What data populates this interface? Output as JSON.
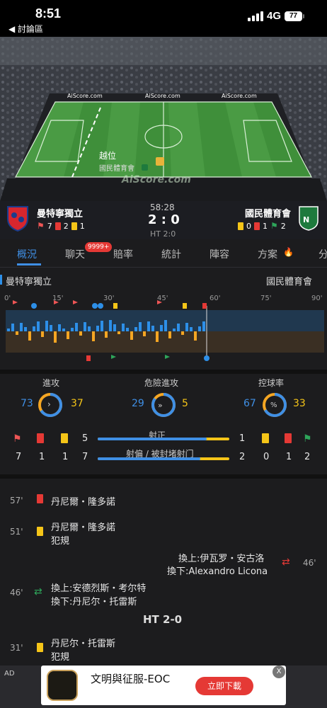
{
  "status": {
    "time": "8:51",
    "back": "◀ 討論區",
    "network": "4G",
    "battery": "77"
  },
  "pitch": {
    "brand": "AiScore.com",
    "watermark": "AiScore.com",
    "event": "越位",
    "event_team": "國民體育會"
  },
  "match": {
    "home": "曼特寧獨立",
    "away": "國民體育會",
    "clock": "58:28",
    "score": "2 : 0",
    "ht": "HT 2:0",
    "home_counts": {
      "corners": "7",
      "red": "2",
      "yellow": "1"
    },
    "away_counts": {
      "yellow": "0",
      "red": "1",
      "corners": "2"
    }
  },
  "tabs": [
    {
      "label": "概況"
    },
    {
      "label": "聊天",
      "badge": "9999+"
    },
    {
      "label": "賠率"
    },
    {
      "label": "統計"
    },
    {
      "label": "陣容"
    },
    {
      "label": "方案"
    },
    {
      "label": "分"
    }
  ],
  "teams_row": {
    "home": "曼特寧獨立",
    "away": "國民體育會"
  },
  "timeline": {
    "ticks": [
      "0'",
      "15'",
      "30'",
      "45'",
      "60'",
      "75'",
      "90'"
    ]
  },
  "stats": {
    "attack": {
      "label": "進攻",
      "home": "73",
      "away": "37",
      "home_share": 0.66
    },
    "danger": {
      "label": "危險進攻",
      "home": "29",
      "away": "5",
      "home_share": 0.85
    },
    "possession": {
      "label": "控球率",
      "home": "67",
      "away": "33",
      "home_share": 0.67
    },
    "on_target": {
      "label": "射正",
      "home": "5",
      "away": "1",
      "home_share": 0.83
    },
    "off_target": {
      "label": "射偏 / 被封堵射门",
      "home": "7",
      "away": "2",
      "home_share": 0.78
    },
    "home_icons": {
      "corners": "7",
      "red": "1",
      "yellow": "1"
    },
    "away_icons": {
      "yellow": "0",
      "red": "1",
      "corners": "2"
    }
  },
  "events": [
    {
      "minute": "57'",
      "side": "home",
      "type": "red",
      "text": "丹尼爾・隆多諾",
      "sub": ""
    },
    {
      "minute": "51'",
      "side": "home",
      "type": "yellow",
      "text": "丹尼爾・隆多諾",
      "sub": "犯規"
    },
    {
      "minute": "46'",
      "side": "away",
      "type": "sub",
      "text": "換上:伊瓦罗・安古洛",
      "sub": "換下:Alexandro Licona"
    },
    {
      "minute": "46'",
      "side": "home",
      "type": "sub",
      "text": "換上:安德烈斯・考尔特",
      "sub": "換下:丹尼尔・托雷斯"
    },
    {
      "minute": "",
      "side": "center",
      "type": "ht",
      "text": "HT 2-0",
      "sub": ""
    },
    {
      "minute": "31'",
      "side": "home",
      "type": "yellow",
      "text": "丹尼尔・托雷斯",
      "sub": "犯規"
    }
  ],
  "ad": {
    "label": "AD",
    "title": "文明與征服-EOC",
    "cta": "立即下載",
    "close": "X"
  }
}
